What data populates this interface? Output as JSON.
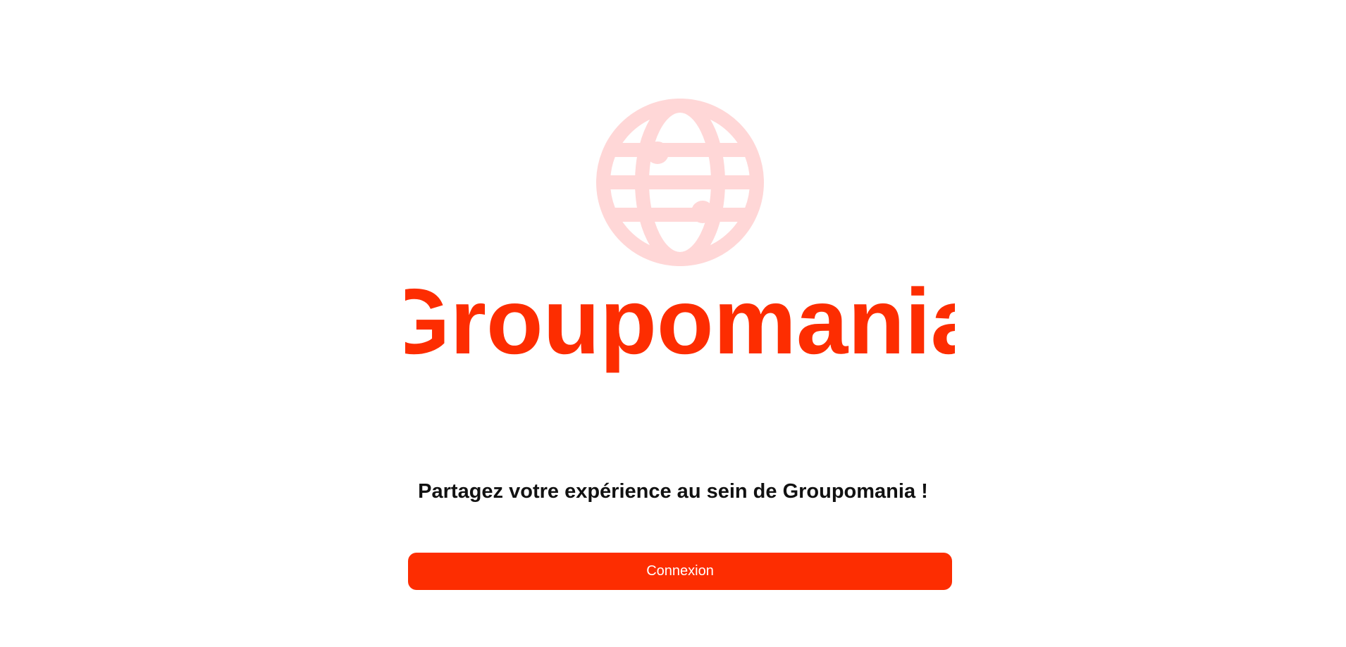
{
  "logo": {
    "icon": "globe-icon",
    "brand_name": "Groupomania",
    "brand_color": "#fd2d01",
    "icon_color": "#ffd7d7"
  },
  "main": {
    "tagline": "Partagez votre expérience au sein de Groupomania !",
    "login_label": "Connexion",
    "button_color": "#fd2d01"
  }
}
